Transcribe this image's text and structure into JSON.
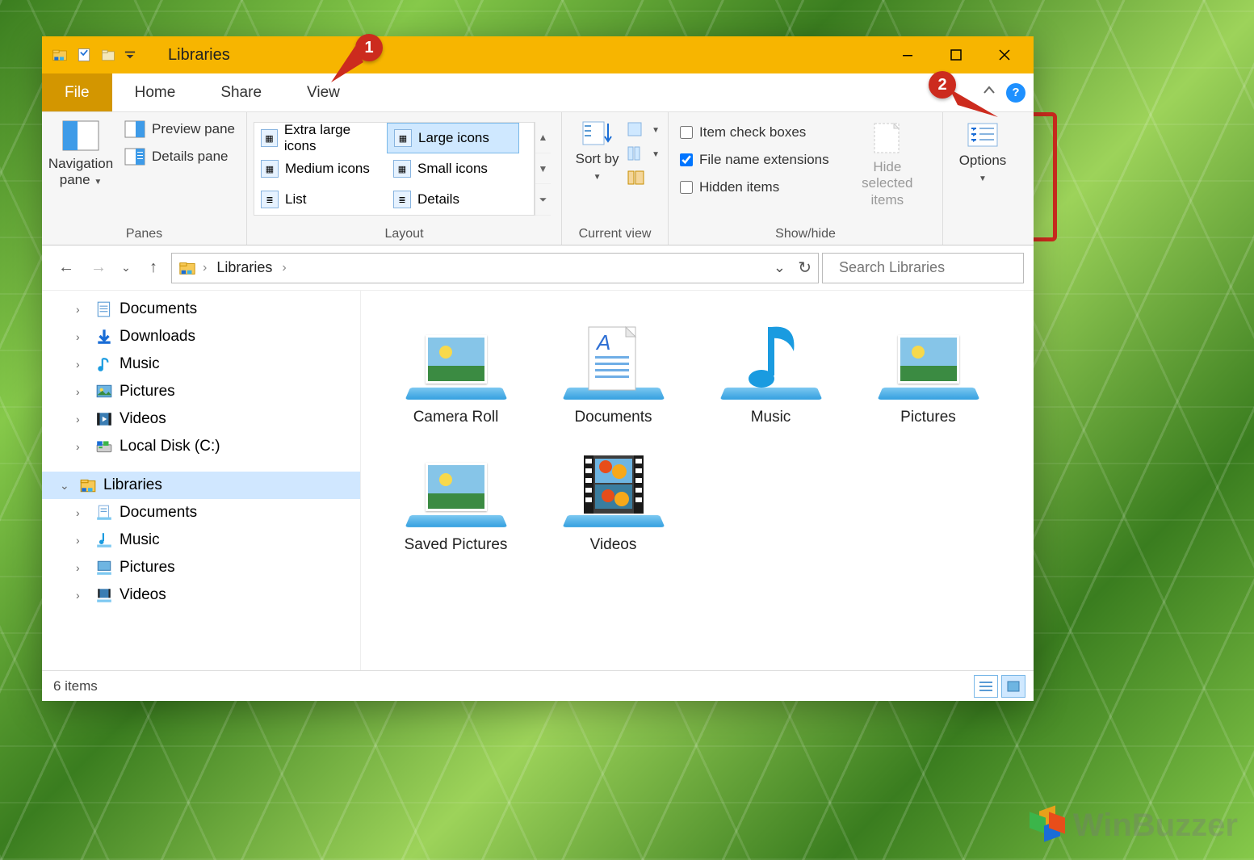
{
  "window": {
    "title": "Libraries"
  },
  "annotations": {
    "callout1": "1",
    "callout2": "2"
  },
  "tabs": {
    "file": "File",
    "home": "Home",
    "share": "Share",
    "view": "View"
  },
  "ribbon": {
    "panes": {
      "navigation": "Navigation pane",
      "preview": "Preview pane",
      "details": "Details pane",
      "group": "Panes"
    },
    "layout": {
      "opts": {
        "xl": "Extra large icons",
        "large": "Large icons",
        "medium": "Medium icons",
        "small": "Small icons",
        "list": "List",
        "details": "Details"
      },
      "group": "Layout"
    },
    "currentview": {
      "sortby": "Sort by",
      "group": "Current view"
    },
    "showhide": {
      "item_check": "Item check boxes",
      "file_ext": "File name extensions",
      "hidden": "Hidden items",
      "hide_selected": "Hide selected items",
      "group": "Show/hide"
    },
    "options": "Options"
  },
  "breadcrumb": {
    "libraries": "Libraries"
  },
  "search": {
    "placeholder": "Search Libraries"
  },
  "tree": {
    "documents": "Documents",
    "downloads": "Downloads",
    "music": "Music",
    "pictures": "Pictures",
    "videos": "Videos",
    "localdisk": "Local Disk (C:)",
    "libraries": "Libraries",
    "lib_documents": "Documents",
    "lib_music": "Music",
    "lib_pictures": "Pictures",
    "lib_videos": "Videos"
  },
  "content_items": {
    "camera_roll": "Camera Roll",
    "documents": "Documents",
    "music": "Music",
    "pictures": "Pictures",
    "saved_pictures": "Saved Pictures",
    "videos": "Videos"
  },
  "status": {
    "count": "6 items"
  },
  "watermark": "WinBuzzer"
}
